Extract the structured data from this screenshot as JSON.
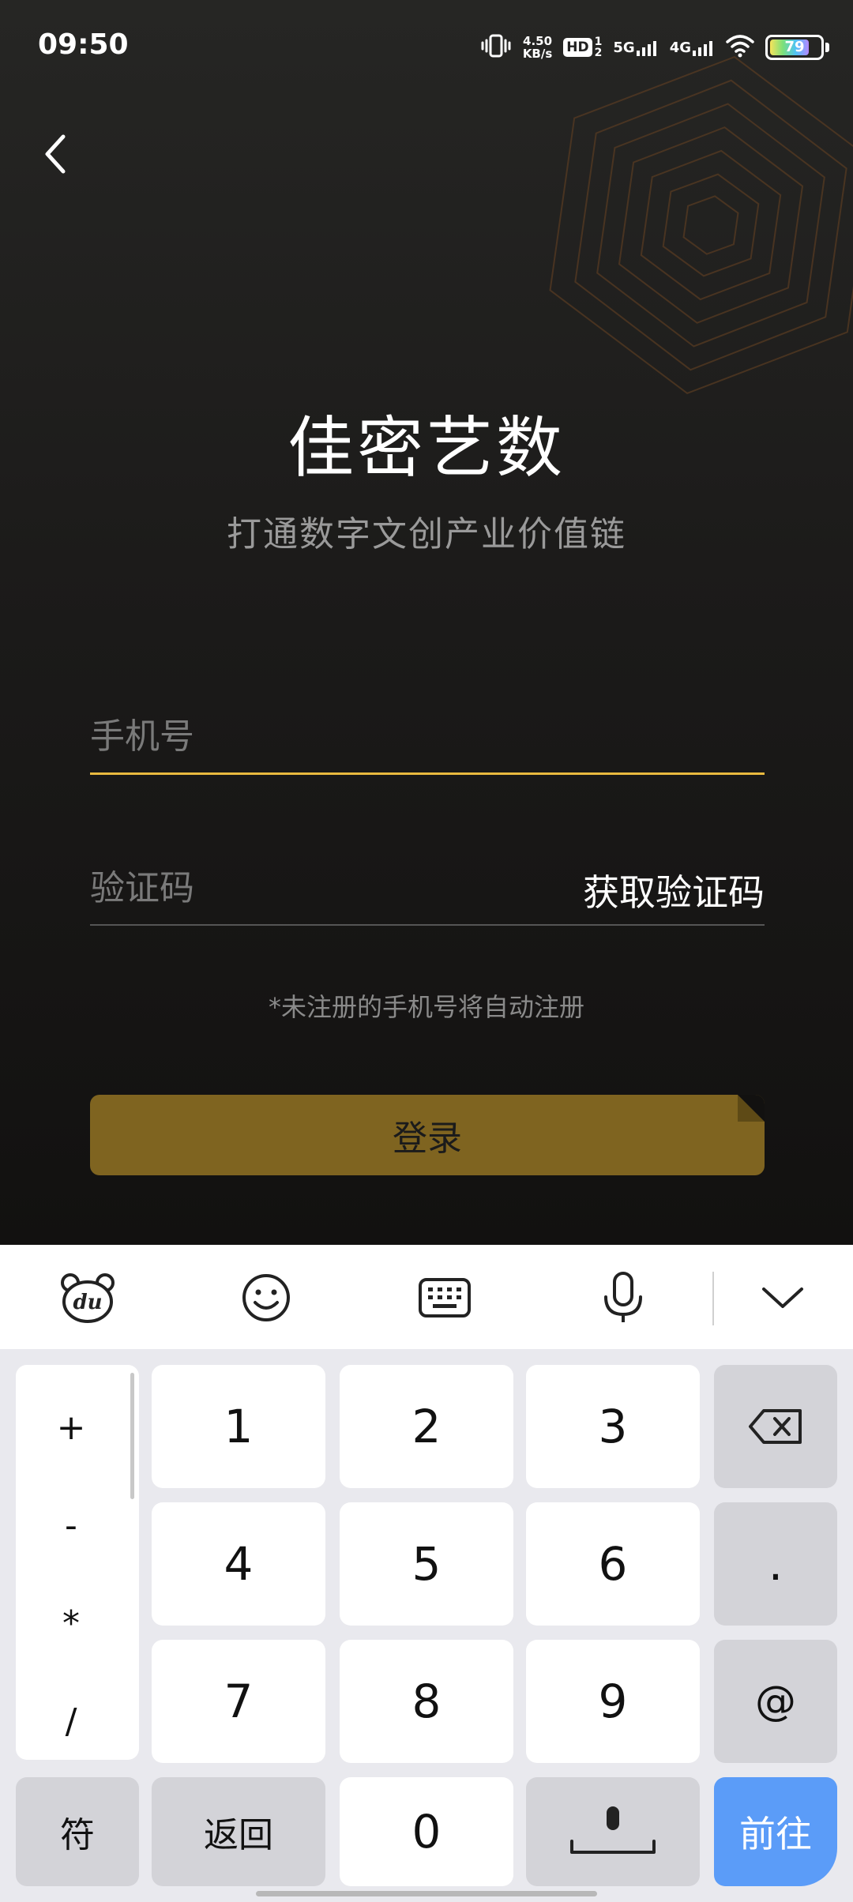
{
  "status_bar": {
    "time": "09:50",
    "net_speed_value": "4.50",
    "net_speed_unit": "KB/s",
    "hd_label": "HD",
    "sim1": "1",
    "sim2": "2",
    "signal1_label": "5G",
    "signal2_label": "4G",
    "battery_level": "79"
  },
  "app": {
    "title": "佳密艺数",
    "subtitle": "打通数字文创产业价值链"
  },
  "form": {
    "phone_placeholder": "手机号",
    "code_placeholder": "验证码",
    "get_code_label": "获取验证码",
    "hint": "*未注册的手机号将自动注册",
    "login_label": "登录"
  },
  "keyboard": {
    "toolbar": [
      "du-bear-icon",
      "emoji-icon",
      "keyboard-icon",
      "microphone-icon",
      "collapse-chevron-icon"
    ],
    "symbols": [
      "+",
      "-",
      "*",
      "/"
    ],
    "digits": [
      "1",
      "2",
      "3",
      "4",
      "5",
      "6",
      "7",
      "8",
      "9",
      "0"
    ],
    "dot": ".",
    "at": "@",
    "symbol_key": "符",
    "back_key": "返回",
    "go_key": "前往"
  },
  "colors": {
    "accent": "#e8b93f",
    "login_button": "#7f6420",
    "go_key": "#5b9cf8"
  }
}
